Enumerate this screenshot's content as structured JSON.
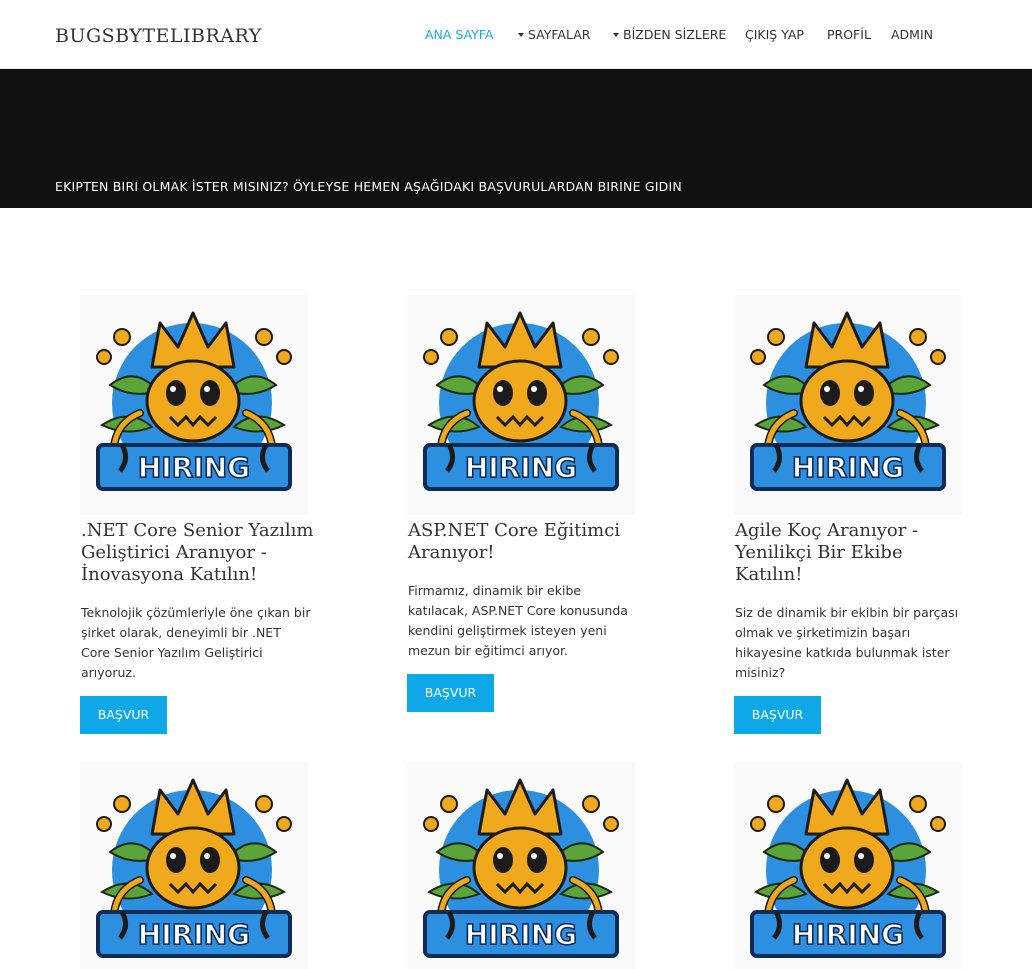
{
  "header": {
    "brand": "BUGSBYTELIBRARY",
    "nav": [
      {
        "label": "ANA SAYFA",
        "active": true
      },
      {
        "label": "SAYFALAR",
        "dropdown": true
      },
      {
        "label": "BİZDEN SİZLERE",
        "dropdown": true
      },
      {
        "label": "ÇIKIŞ YAP"
      },
      {
        "label": "PROFİL"
      },
      {
        "label": "ADMIN"
      }
    ]
  },
  "banner": {
    "text": "EKIPTEN BIRI OLMAK İSTER MISINIZ?  ÖYLEYSE HEMEN AŞAĞIDAKI BAŞVURULARDAN BIRINE GIDIN"
  },
  "image": {
    "badge_text": "HIRING"
  },
  "cards": [
    {
      "title": ".NET Core Senior Yazılım Geliştirici Aranıyor - İnovasyona Katılın!",
      "text": "Teknolojik çözümleriyle öne çıkan bir şirket olarak, deneyimli bir .NET Core Senior Yazılım Geliştirici arıyoruz.",
      "button": "BAŞVUR"
    },
    {
      "title": "ASP.NET Core Eğitimci Aranıyor!",
      "text": "Firmamız, dinamik bir ekibe katılacak, ASP.NET Core konusunda kendini geliştirmek isteyen yeni mezun bir eğitimci arıyor.",
      "button": "BAŞVUR"
    },
    {
      "title": "Agile Koç Aranıyor - Yenilikçi Bir Ekibe Katılın!",
      "text": "Siz de dinamik bir ekibin bir parçası olmak ve şirketimizin başarı hikayesine katkıda bulunmak ister misiniz?",
      "button": "BAŞVUR"
    }
  ],
  "colors": {
    "accent": "#0ea8e8",
    "nav_active": "#1fa9d6",
    "banner_bg": "#111111",
    "mascot_body": "#f0a81c",
    "badge_blue": "#2d8fe0"
  }
}
